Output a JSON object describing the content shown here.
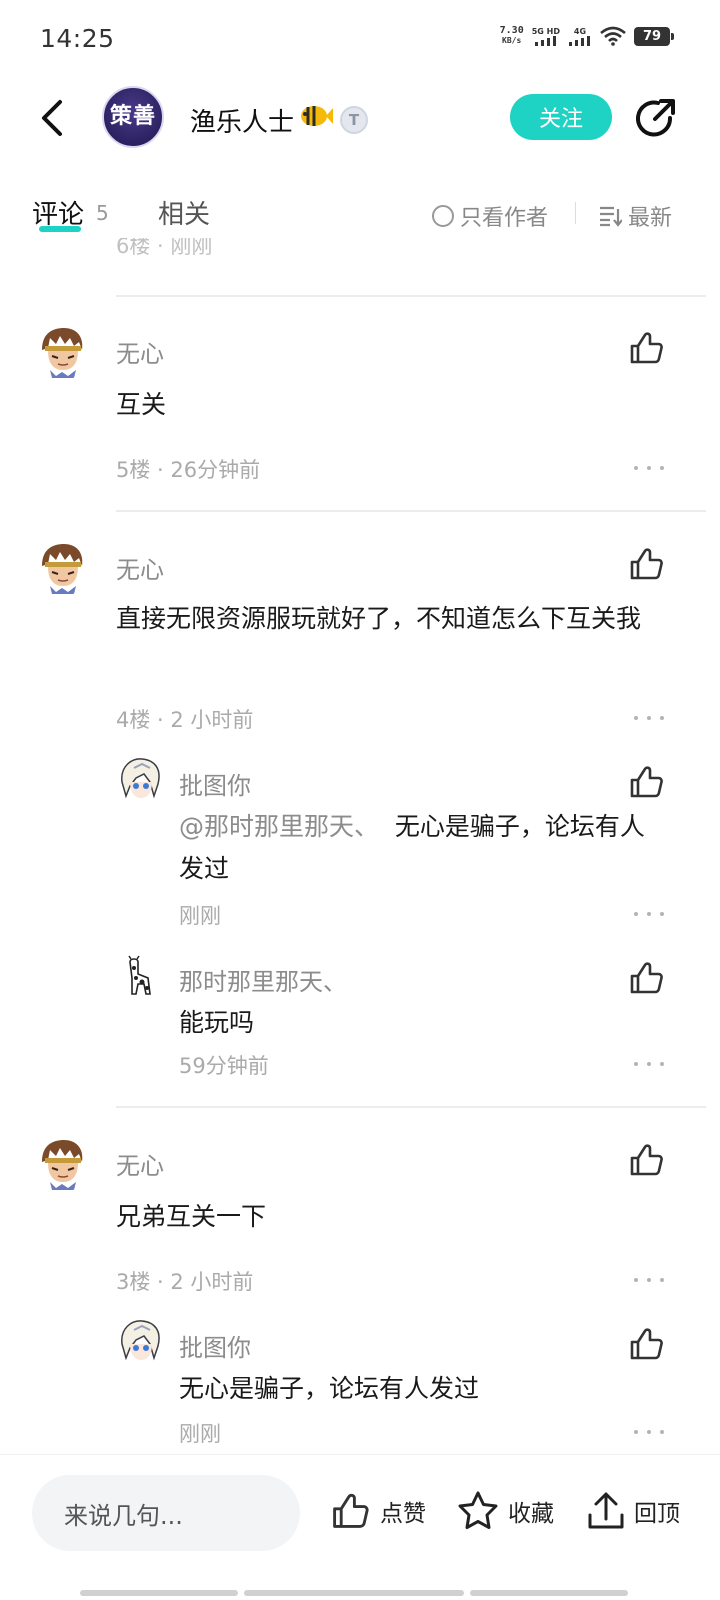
{
  "status_bar": {
    "time": "14:25",
    "net_speed_value": "7.30",
    "net_speed_unit": "KB/s",
    "signal1_label": "5G HD",
    "signal2_label": "4G",
    "battery": "79",
    "icons": [
      "signal-icon",
      "wifi-icon",
      "battery-icon"
    ]
  },
  "header": {
    "author_name": "渔乐人士",
    "follow_label": "关注",
    "avatar_logo_main": "策善",
    "badge": "T",
    "icons": [
      "back-arrow-icon",
      "fish-badge-icon",
      "share-icon"
    ]
  },
  "tabs": {
    "comments_label": "评论",
    "comments_count": "5",
    "related_label": "相关",
    "author_only_label": "只看作者",
    "sort_label": "最新"
  },
  "clipped_meta": "6楼 · 刚刚",
  "comments": [
    {
      "name": "无心",
      "text": "互关",
      "meta": "5楼 · 26分钟前",
      "replies": []
    },
    {
      "name": "无心",
      "text": "直接无限资源服玩就好了，不知道怎么下互关我",
      "meta": "4楼 · 2 小时前",
      "replies": [
        {
          "name": "批图你",
          "mention": "@那时那里那天、",
          "text": "无心是骗子，论坛有人发过",
          "meta": "刚刚"
        },
        {
          "name": "那时那里那天、",
          "text": "能玩吗",
          "meta": "59分钟前"
        }
      ]
    },
    {
      "name": "无心",
      "text": "兄弟互关一下",
      "meta": "3楼 · 2 小时前",
      "replies": [
        {
          "name": "批图你",
          "text": "无心是骗子，论坛有人发过",
          "meta": "刚刚"
        }
      ]
    }
  ],
  "bottom_bar": {
    "input_placeholder": "来说几句...",
    "like_label": "点赞",
    "favorite_label": "收藏",
    "top_label": "回顶"
  },
  "colors": {
    "accent": "#1fd3c4",
    "meta_gray": "#aaaaaa"
  }
}
